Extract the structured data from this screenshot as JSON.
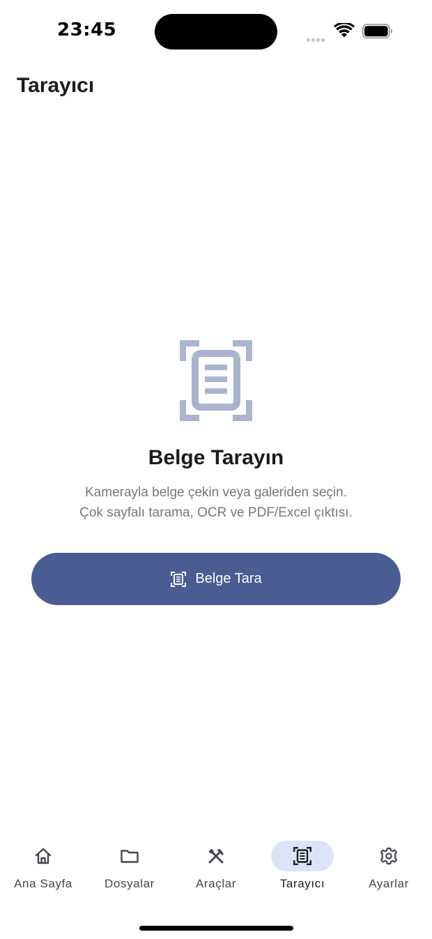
{
  "status_bar": {
    "time": "23:45"
  },
  "header": {
    "title": "Tarayıcı"
  },
  "empty_state": {
    "icon": "document-scanner-icon",
    "title": "Belge Tarayın",
    "description_line1": "Kamerayla belge çekin veya galeriden seçin.",
    "description_line2": "Çok sayfalı tarama, OCR ve PDF/Excel çıktısı."
  },
  "scan_button": {
    "icon": "document-scanner-icon",
    "label": "Belge Tara"
  },
  "bottom_nav": {
    "items": [
      {
        "label": "Ana Sayfa",
        "icon": "home-icon"
      },
      {
        "label": "Dosyalar",
        "icon": "folder-icon"
      },
      {
        "label": "Araçlar",
        "icon": "tools-icon"
      },
      {
        "label": "Tarayıcı",
        "icon": "document-scanner-icon"
      },
      {
        "label": "Ayarlar",
        "icon": "gear-icon"
      }
    ],
    "active_index": 3
  },
  "colors": {
    "primary": "#4a5d93",
    "hero_icon": "#aab4cf",
    "nav_active_pill": "#dde3f7",
    "muted_text": "#77777c",
    "nav_icon": "#44464f"
  }
}
